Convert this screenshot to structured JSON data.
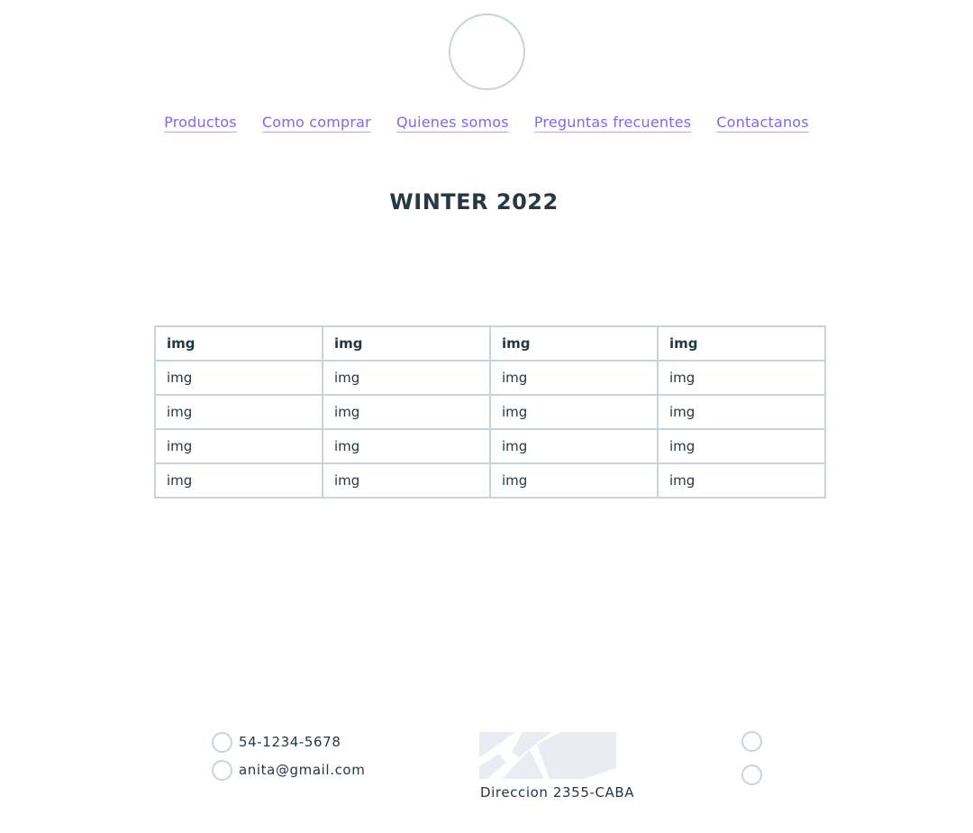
{
  "nav": {
    "items": [
      {
        "label": "Productos"
      },
      {
        "label": "Como comprar"
      },
      {
        "label": "Quienes somos"
      },
      {
        "label": "Preguntas frecuentes"
      },
      {
        "label": "Contactanos"
      }
    ]
  },
  "main": {
    "title": "WINTER 2022"
  },
  "table": {
    "headers": [
      "img",
      "img",
      "img",
      "img"
    ],
    "rows": [
      [
        "img",
        "img",
        "img",
        "img"
      ],
      [
        "img",
        "img",
        "img",
        "img"
      ],
      [
        "img",
        "img",
        "img",
        "img"
      ],
      [
        "img",
        "img",
        "img",
        "img"
      ]
    ]
  },
  "footer": {
    "phone": "54-1234-5678",
    "email": "anita@gmail.com",
    "address": "Direccion 2355-CABA"
  },
  "colors": {
    "link": "#7b6be6",
    "text": "#263843",
    "border": "#c9d3dc"
  }
}
